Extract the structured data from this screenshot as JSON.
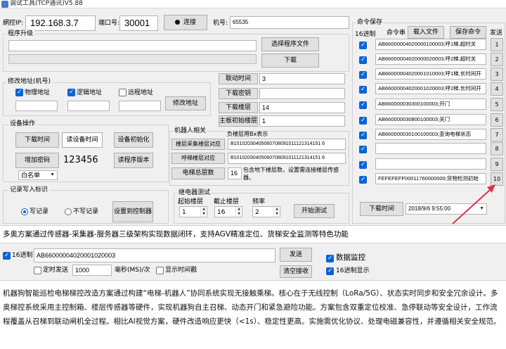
{
  "window": {
    "title": "调试工具(TCP通讯)V5.88"
  },
  "connection": {
    "ip_label": "網控IP:",
    "ip_value": "192.168.3.7",
    "port_label": "端口号:",
    "port_value": "30001",
    "connect_label": "连接",
    "machine_label": "机号:",
    "machine_value": "65535"
  },
  "upgrade": {
    "title": "程序升级",
    "path_value": "",
    "select_label": "选择程序文件",
    "download_label": "下载"
  },
  "modify_address": {
    "title": "修改地址(机号)",
    "physical_label": "物理地址",
    "logical_label": "逻辑地址",
    "remote_label": "远程地址",
    "physical_value": "",
    "logical_value": "",
    "remote_value": "",
    "button_label": "修改地址"
  },
  "params": {
    "rows": [
      {
        "label": "联动时间",
        "value": "3"
      },
      {
        "label": "下载密钥",
        "value": ""
      },
      {
        "label": "下载楼层",
        "value": "14"
      },
      {
        "label": "主板初始楼层",
        "value": "1"
      }
    ]
  },
  "device_ops": {
    "title": "设备操作",
    "download_time": "下载时间",
    "read_time": "读设备时间",
    "init": "设备初始化",
    "add_password": "增加密码",
    "password_value": "123456",
    "read_version": "读程序版本",
    "list_select": "白名单"
  },
  "robot": {
    "title": "机器人相关",
    "subtitle": "负楼层用Bx表示",
    "collect_label": "楼层采集楼层对应",
    "collect_value": "B10102030405060708091011121314151 6",
    "call_label": "呼梯楼层对应",
    "call_value": "B10102030405060708091011121314151 6",
    "total_label": "电梯总层数",
    "total_value": "16",
    "note": "包含地下楼层数，设置需连接楼层传感器。"
  },
  "record": {
    "title": "记录写入标识",
    "write_label": "写记录",
    "nowrite_label": "不写记录",
    "set_label": "设置到控制器"
  },
  "relay": {
    "title": "继电器测试",
    "start_label": "起始楼层",
    "start_value": "1",
    "end_label": "截止楼层",
    "end_value": "16",
    "freq_label": "频率",
    "freq_value": "2",
    "start_test_label": "开始测试"
  },
  "commands": {
    "title": "命令保存",
    "hex_label": "16进制",
    "col_cmd": "命令串",
    "import_label": "载入文件",
    "save_label": "保存命令",
    "send_header": "发送",
    "rows": [
      {
        "text": "AB66000004020000100003;呼1梯,超时关",
        "send": "1"
      },
      {
        "text": "AB66000004020000020003;呼2梯,超时关",
        "send": "2"
      },
      {
        "text": "AB66000004020001010003;呼1梯,长时间开",
        "send": "3"
      },
      {
        "text": "AB66000004020001020003;呼2梯,长时间开",
        "send": "4"
      },
      {
        "text": "AB660000030300100003;开门",
        "send": "5"
      },
      {
        "text": "AB660000030800100003;关门",
        "send": "6"
      },
      {
        "text": "AB660000030100100003;查询电梯状态",
        "send": "7"
      },
      {
        "text": "",
        "send": "8"
      },
      {
        "text": "",
        "send": "9"
      },
      {
        "text": "FEFEFEFF00011760000000;货物检测初始",
        "send": "10"
      }
    ],
    "download_time_label": "下载时间",
    "datetime_value": "2018/9/6 9:55:00"
  },
  "banner": {
    "text": "多奥方案通过传感器-采集器-服务器三级架构实现数据闭环，支持AGV精准定位、货梯安全监测等特色功能"
  },
  "send_bar": {
    "hex_label": "16进制",
    "cmd_value": "AB66000004020001020003",
    "send_label": "发送",
    "monitor_label": "数据监控",
    "timed_label": "定时发送",
    "interval_value": "1000",
    "interval_unit": "毫秒(MS)/次",
    "show_time_label": "显示时间戳",
    "clear_label": "清空接收",
    "hex_show_label": "16进制显示"
  },
  "description": {
    "text": "机器狗智能巡检电梯梯控改造方案通过构建“电梯-机器人”协同系统实现无接触乘梯。核心在于无线控制（LoRa/5G）、状态实时同步和安全冗余设计。多奥梯控系统采用主控制箱、楼层传感器等硬件，实现机器狗自主召梯、动态开门和紧急避险功能。方案包含双重定位校准、急停联动等安全设计，工作流程覆盖从召梯到联动闸机全过程。相比AI视觉方案，硬件改造响应更快（<1s）、稳定性更高。实施需优化协议、处理电磁兼容性，并遵循相关安全规范。"
  },
  "colors": {
    "accent": "#0a64d6",
    "arrow": "#e0334a"
  }
}
